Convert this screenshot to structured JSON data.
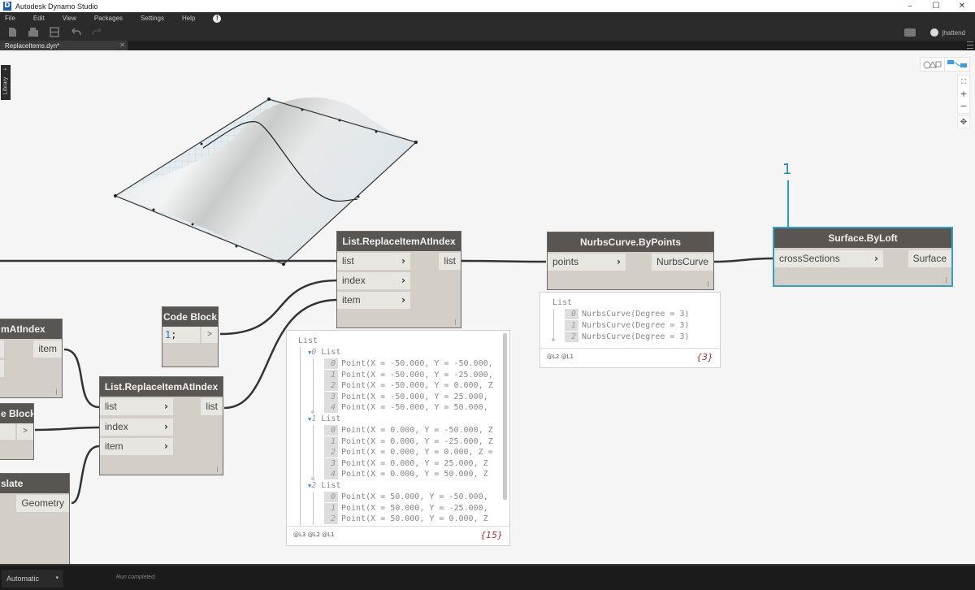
{
  "window": {
    "title": "Autodesk Dynamo Studio",
    "logo_letter": "D",
    "controls": {
      "minimize": "–",
      "maximize": "☐",
      "close": "✕"
    }
  },
  "menu": {
    "items": [
      "File",
      "Edit",
      "View",
      "Packages",
      "Settings",
      "Help"
    ],
    "alert_glyph": "!"
  },
  "toolbar": {
    "icons": [
      "new-file-icon",
      "open-file-icon",
      "save-icon",
      "undo-icon",
      "redo-icon"
    ],
    "username": "jhattend"
  },
  "tabs": [
    {
      "label": "ReplaceItems.dyn*",
      "close": "✕"
    }
  ],
  "library": {
    "label": "Library",
    "arrow": "⇥"
  },
  "view_controls": {
    "fit": "⛶",
    "zoom_in": "+",
    "zoom_out": "−",
    "pan": "✥"
  },
  "nodes": {
    "replace_main": {
      "title": "List.ReplaceItemAtIndex",
      "inputs": [
        "list",
        "index",
        "item"
      ],
      "output": "list"
    },
    "nurbs": {
      "title": "NurbsCurve.ByPoints",
      "inputs": [
        "points"
      ],
      "output": "NurbsCurve"
    },
    "loft": {
      "title": "Surface.ByLoft",
      "inputs": [
        "crossSections"
      ],
      "output": "Surface"
    },
    "code_block": {
      "title": "Code Block",
      "code_num": "1",
      "code_rest": ";",
      "output": ">"
    },
    "partial_getitem": {
      "title": "mAtIndex",
      "output": "item"
    },
    "replace_second": {
      "title": "List.ReplaceItemAtIndex",
      "inputs": [
        "list",
        "index",
        "item"
      ],
      "output": "list"
    },
    "partial_codeblock": {
      "title": "e Block",
      "output": ">"
    },
    "partial_translate": {
      "title": "slate",
      "output": "Geometry"
    }
  },
  "chevron": "›",
  "nurbs_preview": {
    "root": "List",
    "items": [
      {
        "index": "0",
        "value": "NurbsCurve(Degree = 3)"
      },
      {
        "index": "1",
        "value": "NurbsCurve(Degree = 3)"
      },
      {
        "index": "2",
        "value": "NurbsCurve(Degree = 3)"
      }
    ],
    "levels": "@L2 @L1",
    "count": "{3}"
  },
  "points_preview": {
    "root": "List",
    "groups": [
      {
        "index": "0",
        "label": "List",
        "items": [
          {
            "index": "0",
            "value": "Point(X = -50.000, Y = -50.000,"
          },
          {
            "index": "1",
            "value": "Point(X = -50.000, Y = -25.000,"
          },
          {
            "index": "2",
            "value": "Point(X = -50.000, Y = 0.000, Z"
          },
          {
            "index": "3",
            "value": "Point(X = -50.000, Y = 25.000,"
          },
          {
            "index": "4",
            "value": "Point(X = -50.000, Y = 50.000,"
          }
        ]
      },
      {
        "index": "1",
        "label": "List",
        "items": [
          {
            "index": "0",
            "value": "Point(X = 0.000, Y = -50.000, Z"
          },
          {
            "index": "1",
            "value": "Point(X = 0.000, Y = -25.000, Z"
          },
          {
            "index": "2",
            "value": "Point(X = 0.000, Y = 0.000, Z ="
          },
          {
            "index": "3",
            "value": "Point(X = 0.000, Y = 25.000, Z"
          },
          {
            "index": "4",
            "value": "Point(X = 0.000, Y = 50.000, Z"
          }
        ]
      },
      {
        "index": "2",
        "label": "List",
        "items": [
          {
            "index": "0",
            "value": "Point(X = 50.000, Y = -50.000,"
          },
          {
            "index": "1",
            "value": "Point(X = 50.000, Y = -25.000,"
          },
          {
            "index": "2",
            "value": "Point(X = 50.000, Y = 0.000, Z"
          }
        ]
      }
    ],
    "levels": "@L3 @L2 @L1",
    "count": "{15}"
  },
  "annotation": {
    "number": "1",
    "color": "#2b9cc0"
  },
  "statusbar": {
    "run_mode": "Automatic",
    "caret": "▾",
    "status": "Run completed."
  },
  "colors": {
    "node_header": "#585552",
    "node_body": "#d3cfc8",
    "selection": "#37a1c4",
    "wire": "#333333",
    "canvas": "#f5f5f5"
  }
}
